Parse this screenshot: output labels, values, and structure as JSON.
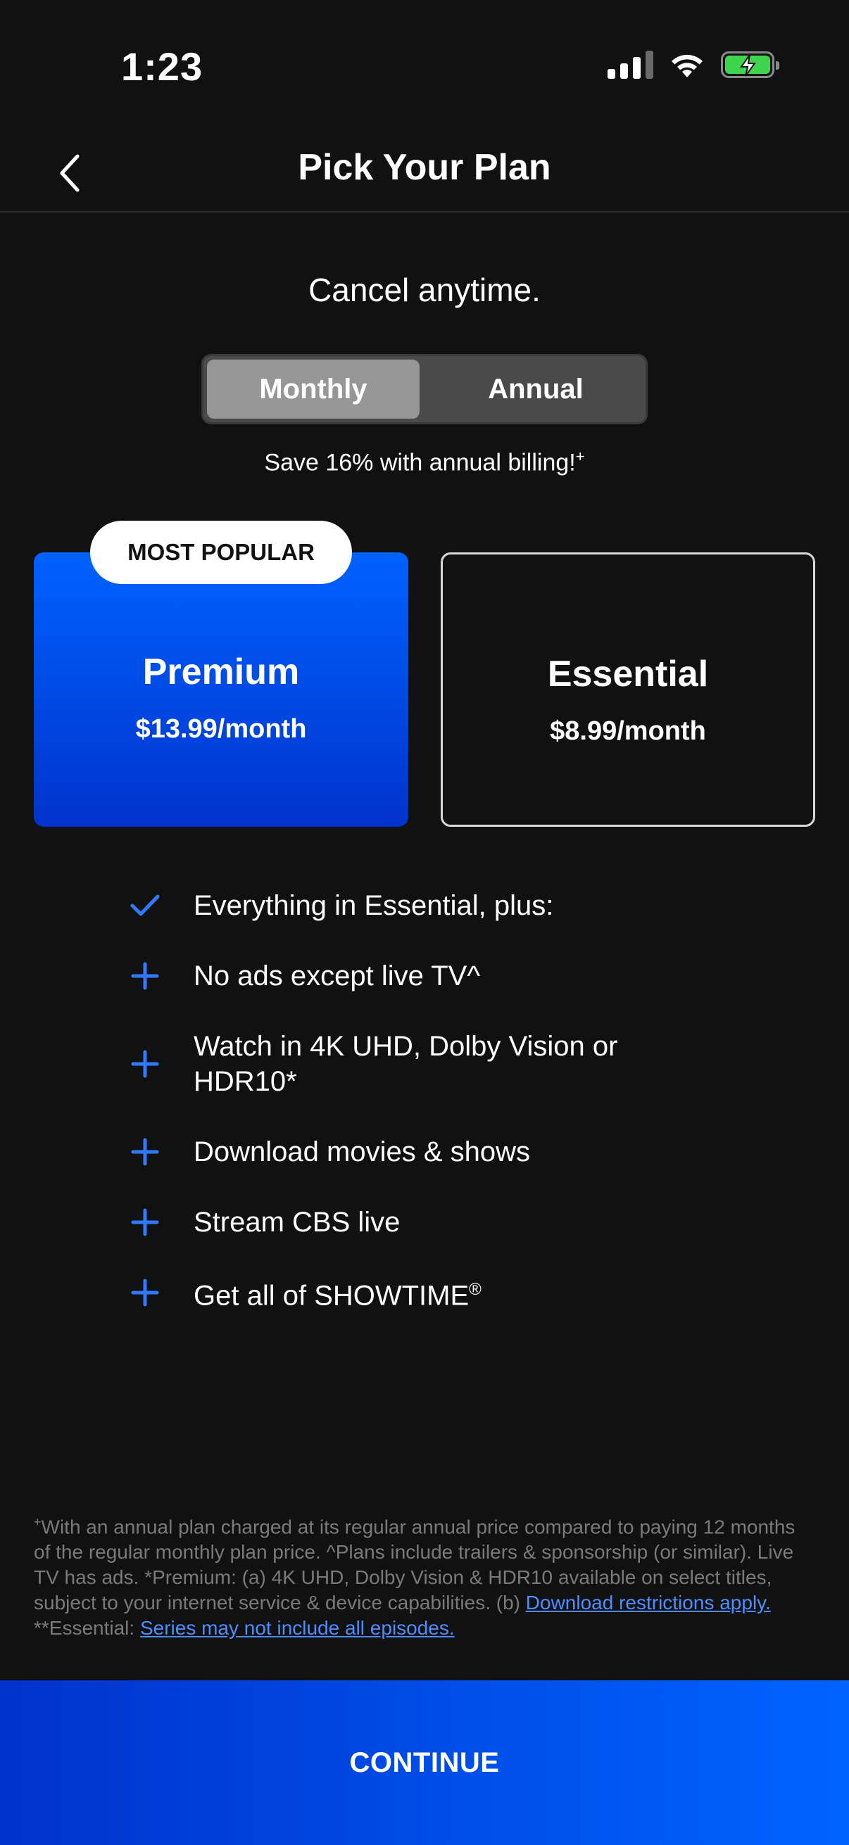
{
  "status_bar": {
    "time": "1:23"
  },
  "header": {
    "title": "Pick Your Plan"
  },
  "intro": {
    "cancel_text": "Cancel anytime."
  },
  "billing_toggle": {
    "monthly_label": "Monthly",
    "annual_label": "Annual",
    "selected": "Monthly"
  },
  "savings": {
    "text": "Save 16% with annual billing!",
    "mark": "+"
  },
  "badge": {
    "label": "MOST POPULAR"
  },
  "plans": [
    {
      "name": "Premium",
      "price": "$13.99/month",
      "selected": true
    },
    {
      "name": "Essential",
      "price": "$8.99/month",
      "selected": false
    }
  ],
  "features": [
    {
      "icon": "check-icon",
      "text": "Everything in Essential, plus:",
      "sup": ""
    },
    {
      "icon": "plus-icon",
      "text": "No ads except live TV^",
      "sup": ""
    },
    {
      "icon": "plus-icon",
      "text": "Watch in 4K UHD, Dolby Vision or",
      "text2": "HDR10*",
      "sup": ""
    },
    {
      "icon": "plus-icon",
      "text": "Download movies & shows",
      "sup": ""
    },
    {
      "icon": "plus-icon",
      "text": "Stream CBS live",
      "sup": ""
    },
    {
      "icon": "plus-icon",
      "text": "Get all of SHOWTIME",
      "sup": "®"
    }
  ],
  "footnote": {
    "mark": "+",
    "text_1": "With an annual plan charged at its regular annual price compared to paying 12 months of the regular monthly plan price. ^Plans include trailers & sponsorship (or similar). Live TV has ads. *Premium: (a) 4K UHD, Dolby Vision & HDR10 available on select titles, subject to your internet service & device capabilities. (b) ",
    "link_1": "Download restrictions apply.",
    "text_2": " **Essential: ",
    "link_2": "Series may not include all episodes."
  },
  "continue": {
    "label": "CONTINUE"
  },
  "colors": {
    "background": "#111111",
    "accent_blue": "#0062ff",
    "link_blue": "#4d8dff",
    "battery_green": "#3fd54f"
  }
}
